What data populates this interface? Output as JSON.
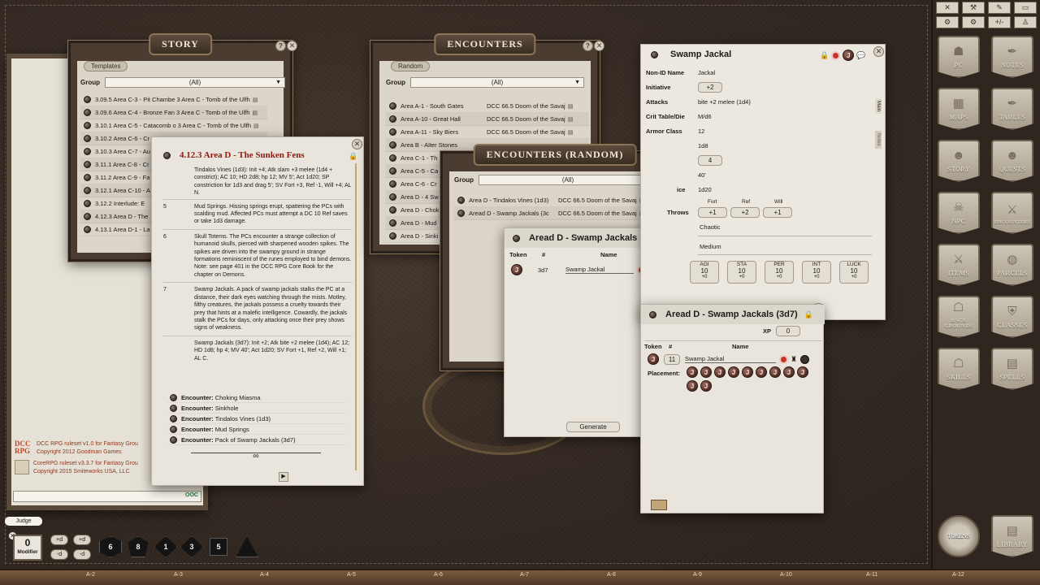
{
  "story_window": {
    "title": "STORY",
    "tab": "Templates",
    "group_label": "Group",
    "group_value": "(All)",
    "items": [
      "3.09.5 Area C-3 - Pit Chambe 3 Area C - Tomb of the Ulfh",
      "3.09.6 Area C-4 - Bronze Fan 3 Area C - Tomb of the Ulfh",
      "3.10.1 Area C-5 - Catacomb o 3 Area C - Tomb of the Ulfh",
      "3.10.2 Area C-6 - Cr",
      "3.10.3 Area C-7 - Au",
      "3.11.1 Area C-8 - Cr",
      "3.11.2 Area C-9 - Fa",
      "3.12.1 Area C-10 - A",
      "3.12.2 Interlude: E",
      "4.12.3 Area D - The",
      "4.13.1 Area D-1 - La"
    ]
  },
  "chat_window": {
    "credits": [
      {
        "logo": "DCC RPG",
        "line1": "DCC RPG ruleset v1.0 for Fantasy Grou",
        "line2": "Copyright 2012 Goodman Games"
      },
      {
        "logo": "",
        "line1": "CoreRPG ruleset v3.3.7 for Fantasy Grou",
        "line2": "Copyright 2015 Smiteworks USA, LLC"
      }
    ],
    "input_tag": "OOC"
  },
  "story_entry": {
    "title": "4.12.3 Area D - The Sunken Fens",
    "table_rows": [
      {
        "num": "",
        "text": "Tindalos Vines (1d3): Init +4; Atk slam +3 melee (1d4 + constrict); AC 10; HD 2d8; hp 12; MV 5'; Act 1d20; SP constriction for 1d3 and drag 5'; SV Fort +3, Ref -1, Will +4; AL N."
      },
      {
        "num": "5",
        "text": "Mud Springs. Hissing springs erupt, spattering the PCs with scalding mud. Affected PCs must attempt a DC 10 Ref saves or take 1d3 damage."
      },
      {
        "num": "6",
        "text": "Skull Totems. The PCs encounter a strange collection of humanoid skulls, pierced with sharpened wooden spikes. The spikes are driven into the swampy ground in strange formations reminiscent of the runes employed to bind demons. Note: see page 401 in the DCC RPG Core Book for the chapter on Demons."
      },
      {
        "num": "7",
        "text": "Swamp Jackals. A pack of swamp jackals stalks the PC at a distance, their dark eyes watching through the mists. Motley, filthy creatures, the jackals possess a cruelty towards their prey that hints at a malefic intelligence. Cowardly, the jackals stalk the PCs for days, only attacking once their prey shows signs of weakness."
      },
      {
        "num": "",
        "text": "Swamp Jackals (3d7): Init +2; Atk bite +2 melee (1d4); AC 12; HD 1d8; hp 4; MV 40'; Act 1d20; SV Fort +1, Ref +2, Will +1; AL C."
      }
    ],
    "links": [
      {
        "label": "Encounter:",
        "value": "Choking Miasma"
      },
      {
        "label": "Encounter:",
        "value": "Sinkhole"
      },
      {
        "label": "Encounter:",
        "value": "Tindalos Vines (1d3)"
      },
      {
        "label": "Encounter:",
        "value": "Mud Springs"
      },
      {
        "label": "Encounter:",
        "value": "Pack of Swamp Jackals (3d7)"
      }
    ]
  },
  "encounters_window": {
    "title": "ENCOUNTERS",
    "tab": "Random",
    "group_label": "Group",
    "group_value": "(All)",
    "items": [
      {
        "name": "Area A-1 - South Gates",
        "src": "DCC 66.5 Doom of the Savaj"
      },
      {
        "name": "Area A-10 - Great Hall",
        "src": "DCC 66.5 Doom of the Savaj"
      },
      {
        "name": "Area A-11 - Sky Biers",
        "src": "DCC 66.5 Doom of the Savaj"
      },
      {
        "name": "Area B - Alter Stones",
        "src": ""
      },
      {
        "name": "Area C-1 - Th",
        "src": ""
      },
      {
        "name": "Area C-5 - Ca",
        "src": ""
      },
      {
        "name": "Area C-6 - Cr",
        "src": ""
      },
      {
        "name": "Area D - 4 Sw",
        "src": ""
      },
      {
        "name": "Area D - Chok",
        "src": ""
      },
      {
        "name": "Area D - Mud",
        "src": ""
      },
      {
        "name": "Area D - Sinki",
        "src": ""
      }
    ]
  },
  "encounters_random_window": {
    "title": "ENCOUNTERS (RANDOM)",
    "group_label": "Group",
    "group_value": "(All)",
    "items": [
      {
        "name": "Area D - Tindalos Vines (1d3)",
        "src": "DCC 66.5 Doom of the Savaj"
      },
      {
        "name": "Aread D - Swamp Jackals (3c",
        "src": "DCC 66.5 Doom of the Savaj"
      }
    ]
  },
  "random_encounter_detail": {
    "title": "Aread D - Swamp Jackals (3d7)",
    "col_token": "Token",
    "col_num": "#",
    "col_name": "Name",
    "row": {
      "token": "J",
      "num": "3d7",
      "name": "Swamp Jackal"
    },
    "generate_label": "Generate"
  },
  "npc_sheet": {
    "title": "Swamp Jackal",
    "side_tabs": [
      "Main",
      "Notes"
    ],
    "fields": {
      "nonid_label": "Non-ID Name",
      "nonid_value": "Jackal",
      "init_label": "Initiative",
      "init_value": "+2",
      "attacks_label": "Attacks",
      "attacks_value": "bite +2 melee (1d4)",
      "crit_label": "Crit Table/Die",
      "crit_value": "M/d6",
      "ac_label": "Armor Class",
      "ac_value": "12",
      "hd_value": "1d8",
      "hp_value": "4",
      "speed_value": "40'",
      "actdice_label": "ice",
      "actdice_value": "1d20",
      "saves_label": "Throws",
      "fort_label": "Fort",
      "fort_value": "+1",
      "ref_label": "Ref",
      "ref_value": "+2",
      "will_label": "Will",
      "will_value": "+1",
      "alignment_value": "Chaotic",
      "size_value": "Medium"
    },
    "abilities": [
      {
        "name": "AGI",
        "score": "10",
        "mod": "+0"
      },
      {
        "name": "STA",
        "score": "10",
        "mod": "+0"
      },
      {
        "name": "PER",
        "score": "10",
        "mod": "+0"
      },
      {
        "name": "INT",
        "score": "10",
        "mod": "+0"
      },
      {
        "name": "LUCK",
        "score": "10",
        "mod": "+0"
      }
    ]
  },
  "encounter_detail": {
    "title": "Aread D - Swamp Jackals (3d7)",
    "xp_label": "XP",
    "xp_value": "0",
    "col_token": "Token",
    "col_num": "#",
    "col_name": "Name",
    "row": {
      "token": "J",
      "num": "11",
      "name": "Swamp Jackal"
    },
    "placement_label": "Placement:",
    "placement_tokens": [
      "J",
      "J",
      "J",
      "J",
      "J",
      "J",
      "J",
      "J",
      "J",
      "J",
      "J"
    ]
  },
  "sidebar": {
    "top_tools": [
      "✕",
      "⚒",
      "✎",
      "▭",
      "⚙",
      "⚙",
      "+/-",
      "♙"
    ],
    "buttons": [
      {
        "label": "PC",
        "icon": "helmet-icon"
      },
      {
        "label": "NOTES",
        "icon": "quill-icon"
      },
      {
        "label": "MAPS",
        "icon": "map-icon"
      },
      {
        "label": "TABLES",
        "icon": "quill-icon"
      },
      {
        "label": "STORY",
        "icon": "masks-icon"
      },
      {
        "label": "QUESTS",
        "icon": "masks-icon"
      },
      {
        "label": "NPC",
        "icon": "skull-icon"
      },
      {
        "label": "ENCOUNTERS",
        "icon": "crossed-axes-icon"
      },
      {
        "label": "ITEMS",
        "icon": "sword-icon"
      },
      {
        "label": "PARCELS",
        "icon": "bag-icon"
      },
      {
        "label": "BACK GROUNDS",
        "icon": "hood-icon"
      },
      {
        "label": "CLASSES",
        "icon": "shield-icon"
      },
      {
        "label": "SKILLS",
        "icon": "hood-icon"
      },
      {
        "label": "SPELLS",
        "icon": "book-icon"
      }
    ],
    "tokens_label": "TOKENS",
    "library_label": "LIBRARY"
  },
  "bottom": {
    "user_label": "Judge",
    "modifier_value": "0",
    "modifier_label": "Modifier",
    "dice_buttons": [
      "+d",
      "+d",
      "-d",
      "-d"
    ],
    "dice": [
      "6",
      "8",
      "1",
      "3",
      "5",
      ""
    ],
    "ruler": [
      "A-2",
      "A-3",
      "A-4",
      "A-5",
      "A-6",
      "A-7",
      "A-8",
      "A-9",
      "A-10",
      "A-11",
      "A-12"
    ]
  },
  "colors": {
    "accent_red": "#8a1d12",
    "parchment": "#e9e5dc",
    "leather": "#3a2f26"
  }
}
